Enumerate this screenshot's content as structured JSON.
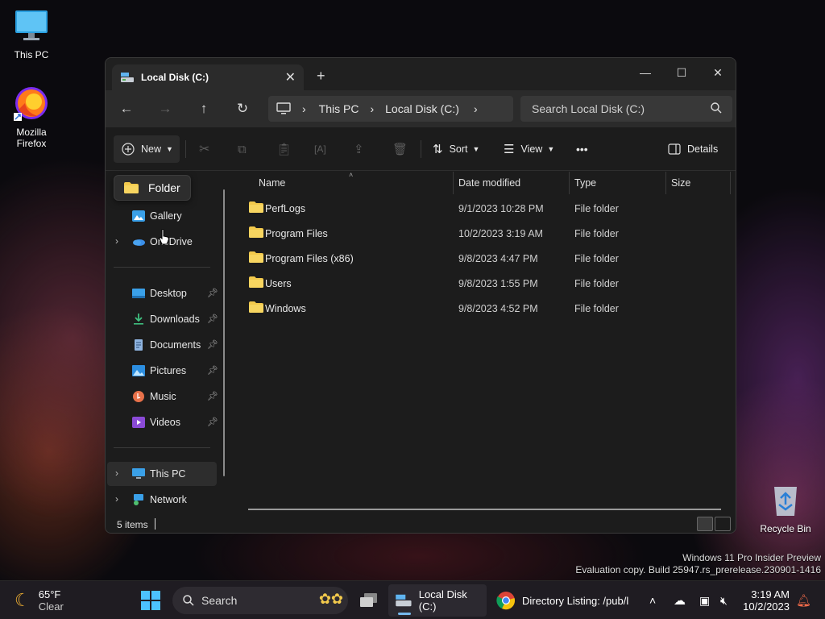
{
  "desktop": {
    "icons": [
      {
        "label": "This PC",
        "icon": "monitor-icon"
      },
      {
        "label": "Mozilla Firefox",
        "line1": "Mozilla",
        "line2": "Firefox",
        "icon": "firefox-icon"
      },
      {
        "label": "Recycle Bin",
        "icon": "recycle-bin-icon"
      }
    ],
    "watermark": {
      "line1": "Windows 11 Pro Insider Preview",
      "line2": "Evaluation copy. Build 25947.rs_prerelease.230901-1416"
    }
  },
  "window": {
    "tab_title": "Local Disk (C:)",
    "new_tab": "+",
    "controls": {
      "minimize": "—",
      "maximize": "☐",
      "close": "✕"
    },
    "breadcrumb": [
      "This PC",
      "Local Disk (C:)"
    ],
    "search_placeholder": "Search Local Disk (C:)",
    "toolbar": {
      "new_label": "New",
      "sort_label": "Sort",
      "view_label": "View",
      "more_label": "•••",
      "details_label": "Details"
    },
    "sidebar": {
      "tooltip": "Folder",
      "top_items": [
        {
          "label": "Gallery",
          "icon": "gallery-icon"
        },
        {
          "label": "OneDrive",
          "icon": "onedrive-icon"
        }
      ],
      "pinned": [
        {
          "label": "Desktop",
          "icon": "desktop-icon"
        },
        {
          "label": "Downloads",
          "icon": "downloads-icon"
        },
        {
          "label": "Documents",
          "icon": "documents-icon"
        },
        {
          "label": "Pictures",
          "icon": "pictures-icon"
        },
        {
          "label": "Music",
          "icon": "music-icon"
        },
        {
          "label": "Videos",
          "icon": "videos-icon"
        }
      ],
      "bottom_items": [
        {
          "label": "This PC",
          "icon": "this-pc-icon"
        },
        {
          "label": "Network",
          "icon": "network-icon"
        }
      ]
    },
    "columns": [
      "Name",
      "Date modified",
      "Type",
      "Size"
    ],
    "files": [
      {
        "name": "PerfLogs",
        "date": "9/1/2023 10:28 PM",
        "type": "File folder"
      },
      {
        "name": "Program Files",
        "date": "10/2/2023 3:19 AM",
        "type": "File folder"
      },
      {
        "name": "Program Files (x86)",
        "date": "9/8/2023 4:47 PM",
        "type": "File folder"
      },
      {
        "name": "Users",
        "date": "9/8/2023 1:55 PM",
        "type": "File folder"
      },
      {
        "name": "Windows",
        "date": "9/8/2023 4:52 PM",
        "type": "File folder"
      }
    ],
    "status": "5 items"
  },
  "taskbar": {
    "weather": {
      "temp": "65°F",
      "condition": "Clear"
    },
    "search_label": "Search",
    "explorer_label": "Local Disk (C:)",
    "chrome_label": "Directory Listing: /pub/l",
    "time": "3:19 AM",
    "date": "10/2/2023"
  },
  "colors": {
    "accent": "#76b9ed",
    "folder": "#f2c94c",
    "window_bg": "#1c1c1c",
    "taskbar_bg": "#1f1c22"
  }
}
